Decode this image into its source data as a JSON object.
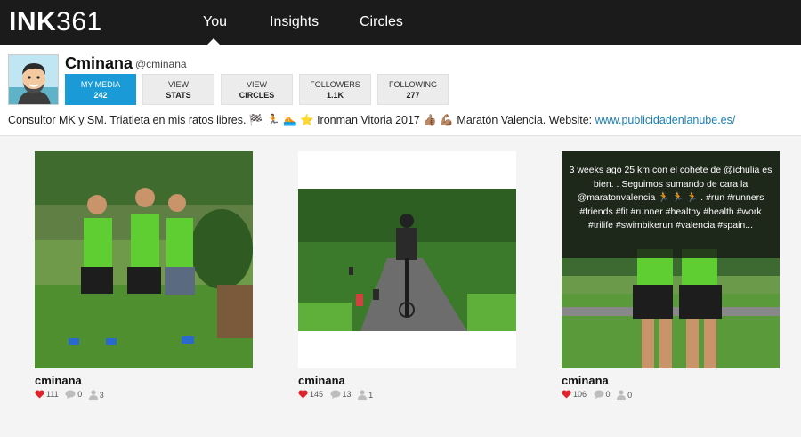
{
  "app": {
    "logo_bold": "INK",
    "logo_thin": "361"
  },
  "nav": {
    "items": [
      {
        "label": "You"
      },
      {
        "label": "Insights"
      },
      {
        "label": "Circles"
      }
    ],
    "active": "You"
  },
  "profile": {
    "display_name": "Cminana",
    "username": "@cminana",
    "buttons": [
      {
        "line1": "MY MEDIA",
        "line2": "242"
      },
      {
        "line1": "VIEW",
        "line2": "STATS"
      },
      {
        "line1": "VIEW",
        "line2": "CIRCLES"
      },
      {
        "line1": "FOLLOWERS",
        "line2": "1.1K"
      },
      {
        "line1": "FOLLOWING",
        "line2": "277"
      }
    ],
    "bio_text": "Consultor MK y SM. Triatleta en mis ratos libres. 🏁 🏃 🏊 ⭐ Ironman Vitoria 2017 👍🏽 💪🏽 Maratón Valencia. Website: ",
    "bio_link": "www.publicidadenlanube.es/"
  },
  "posts": [
    {
      "user": "cminana",
      "likes": "111",
      "comments": "0",
      "tags": "3"
    },
    {
      "user": "cminana",
      "likes": "145",
      "comments": "13",
      "tags": "1"
    },
    {
      "user": "cminana",
      "likes": "106",
      "comments": "0",
      "tags": "0",
      "caption": "3 weeks ago 25 km con el cohete de @ichulia es bien. . Seguimos sumando de cara la @maratonvalencia 🏃 🏃 🏃 . #run #runners #friends #fit #runner #healthy #health #work #trilife #swimbikerun #valencia #spain..."
    }
  ],
  "colors": {
    "topbar": "#1b1b1b",
    "accent": "#1a9bd8",
    "link": "#1a7fb5",
    "heart": "#e0242b"
  }
}
